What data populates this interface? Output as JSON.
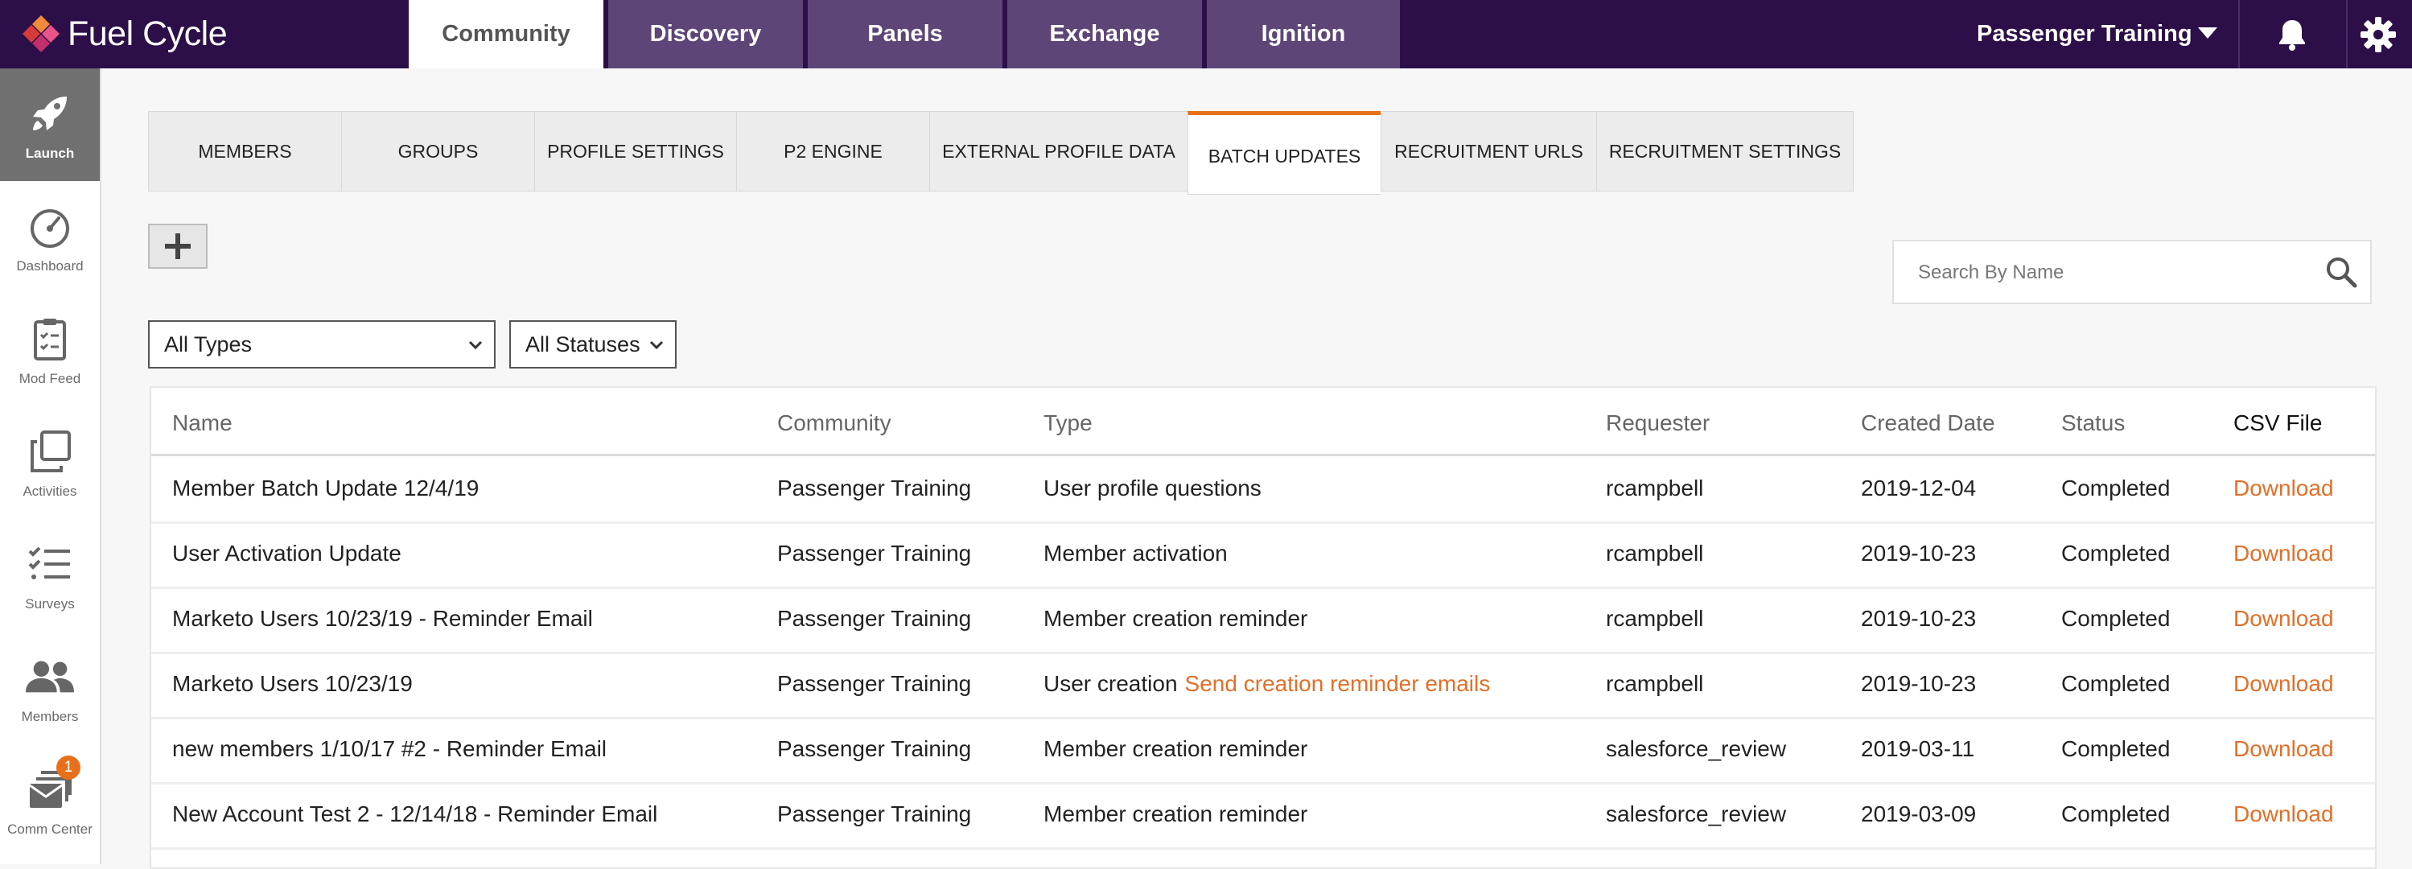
{
  "brand": {
    "name": "Fuel Cycle"
  },
  "top_tabs": [
    {
      "label": "Community",
      "active": true
    },
    {
      "label": "Discovery",
      "active": false
    },
    {
      "label": "Panels",
      "active": false
    },
    {
      "label": "Exchange",
      "active": false
    },
    {
      "label": "Ignition",
      "active": false
    }
  ],
  "account": {
    "name": "Passenger Training"
  },
  "sidebar": {
    "items": [
      {
        "label": "Launch",
        "icon": "rocket-icon",
        "active": true
      },
      {
        "label": "Dashboard",
        "icon": "gauge-icon"
      },
      {
        "label": "Mod Feed",
        "icon": "clipboard-icon"
      },
      {
        "label": "Activities",
        "icon": "copy-icon"
      },
      {
        "label": "Surveys",
        "icon": "checklist-icon"
      },
      {
        "label": "Members",
        "icon": "users-icon"
      },
      {
        "label": "Comm Center",
        "icon": "mail-stack-icon",
        "badge": "1"
      }
    ]
  },
  "sub_tabs": [
    {
      "label": "MEMBERS"
    },
    {
      "label": "GROUPS"
    },
    {
      "label": "PROFILE SETTINGS"
    },
    {
      "label": "P2 ENGINE"
    },
    {
      "label": "EXTERNAL PROFILE DATA"
    },
    {
      "label": "BATCH UPDATES",
      "active": true
    },
    {
      "label": "RECRUITMENT URLS"
    },
    {
      "label": "RECRUITMENT SETTINGS"
    }
  ],
  "search": {
    "placeholder": "Search By Name",
    "value": ""
  },
  "filters": {
    "type_selected": "All Types",
    "status_selected": "All Statuses"
  },
  "table": {
    "headers": {
      "name": "Name",
      "community": "Community",
      "type": "Type",
      "requester": "Requester",
      "created": "Created Date",
      "status": "Status",
      "csv": "CSV File"
    },
    "rows": [
      {
        "name": "Member Batch Update 12/4/19",
        "community": "Passenger Training",
        "type": "User profile questions",
        "type_link": "",
        "requester": "rcampbell",
        "created": "2019-12-04",
        "status": "Completed",
        "csv": "Download"
      },
      {
        "name": "User Activation Update",
        "community": "Passenger Training",
        "type": "Member activation",
        "type_link": "",
        "requester": "rcampbell",
        "created": "2019-10-23",
        "status": "Completed",
        "csv": "Download"
      },
      {
        "name": "Marketo Users 10/23/19 - Reminder Email",
        "community": "Passenger Training",
        "type": "Member creation reminder",
        "type_link": "",
        "requester": "rcampbell",
        "created": "2019-10-23",
        "status": "Completed",
        "csv": "Download"
      },
      {
        "name": "Marketo Users 10/23/19",
        "community": "Passenger Training",
        "type": "User creation",
        "type_link": "Send creation reminder emails",
        "requester": "rcampbell",
        "created": "2019-10-23",
        "status": "Completed",
        "csv": "Download"
      },
      {
        "name": "new members 1/10/17 #2 - Reminder Email",
        "community": "Passenger Training",
        "type": "Member creation reminder",
        "type_link": "",
        "requester": "salesforce_review",
        "created": "2019-03-11",
        "status": "Completed",
        "csv": "Download"
      },
      {
        "name": "New Account Test 2 - 12/14/18 - Reminder Email",
        "community": "Passenger Training",
        "type": "Member creation reminder",
        "type_link": "",
        "requester": "salesforce_review",
        "created": "2019-03-09",
        "status": "Completed",
        "csv": "Download"
      }
    ]
  },
  "colors": {
    "topbar": "#2c0f49",
    "tab_inactive": "#5d4578",
    "accent": "#e8701a",
    "link": "#e0702a"
  }
}
